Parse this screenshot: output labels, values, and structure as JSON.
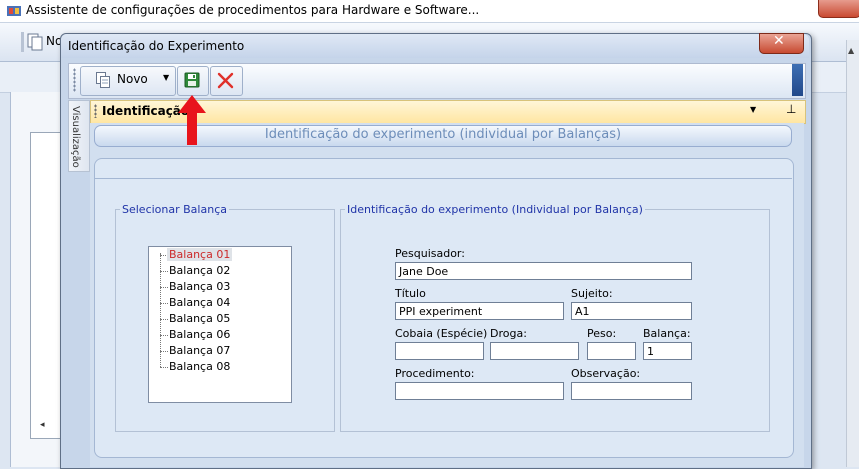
{
  "main_window": {
    "title": "Assistente de configurações de procedimentos para Hardware e Software...",
    "toolbar_button_partial": "No"
  },
  "dialog": {
    "title": "Identificação do Experimento",
    "toolbar": {
      "novo_label": "Novo"
    },
    "side_tab_label": "Visualização",
    "panel_title": "Identificação",
    "banner_title": "Identificação do experimento (individual por Balanças)"
  },
  "select_balanca": {
    "legend": "Selecionar Balança",
    "items": [
      "Balança 01",
      "Balança 02",
      "Balança 03",
      "Balança 04",
      "Balança 05",
      "Balança 06",
      "Balança 07",
      "Balança 08"
    ],
    "selected_index": 0
  },
  "form": {
    "legend": "Identificação do experimento (Individual por Balança)",
    "pesquisador": {
      "label": "Pesquisador:",
      "value": "Jane Doe"
    },
    "titulo": {
      "label": "Título",
      "value": "PPI experiment"
    },
    "sujeito": {
      "label": "Sujeito:",
      "value": "A1"
    },
    "cobaia": {
      "label": "Cobaia (Espécie)",
      "value": ""
    },
    "droga": {
      "label": "Droga:",
      "value": ""
    },
    "peso": {
      "label": "Peso:",
      "value": ""
    },
    "balanca": {
      "label": "Balança:",
      "value": "1"
    },
    "procedimento": {
      "label": "Procedimento:",
      "value": ""
    },
    "observacao": {
      "label": "Observação:",
      "value": ""
    }
  },
  "colors": {
    "selected_text": "#cc2a2a",
    "legend_text": "#2034a8",
    "annotation_arrow": "#e8141c",
    "panel_header": "#ffe6a2"
  }
}
